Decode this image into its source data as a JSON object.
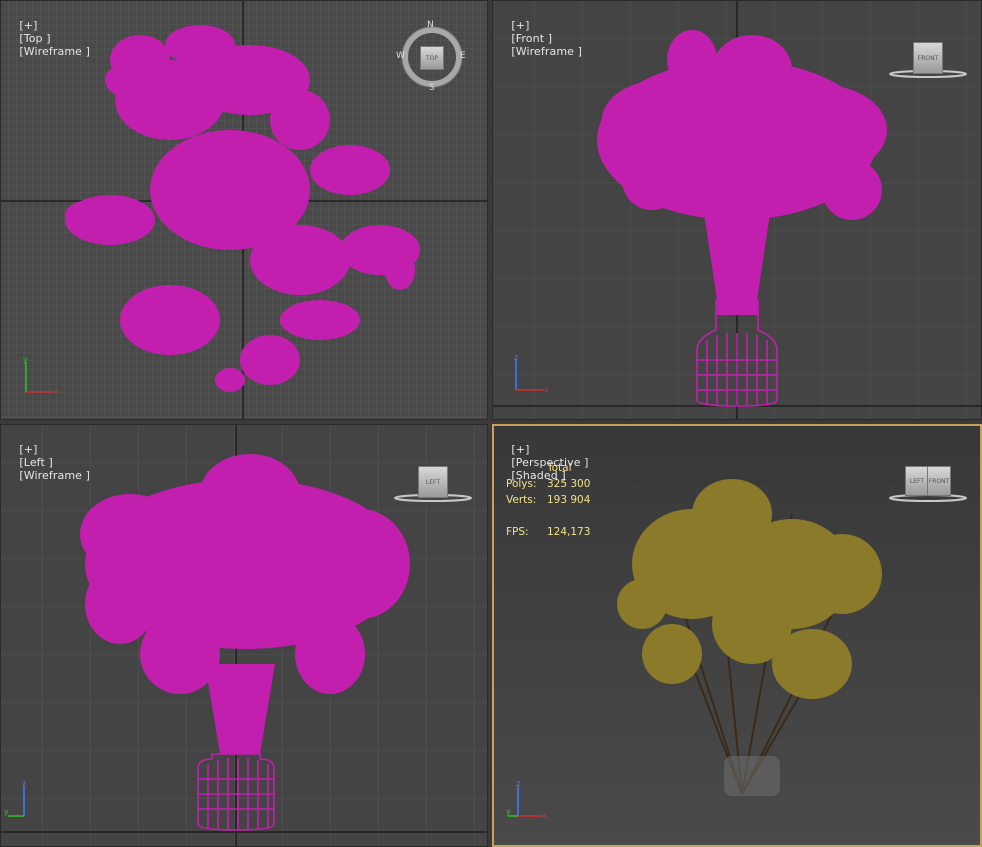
{
  "viewports": {
    "top": {
      "plus": "[+]",
      "name": "[Top ]",
      "mode": "[Wireframe ]"
    },
    "front": {
      "plus": "[+]",
      "name": "[Front ]",
      "mode": "[Wireframe ]"
    },
    "left": {
      "plus": "[+]",
      "name": "[Left ]",
      "mode": "[Wireframe ]"
    },
    "persp": {
      "plus": "[+]",
      "name": "[Perspective ]",
      "mode": "[Shaded ]"
    }
  },
  "viewcube": {
    "top": "TOP",
    "front": "FRONT",
    "left": "LEFT",
    "persp_left": "LEFT",
    "persp_front": "FRONT",
    "compass": {
      "n": "N",
      "s": "S",
      "e": "E",
      "w": "W"
    }
  },
  "stats": {
    "header": "Total",
    "polys_label": "Polys:",
    "polys_value": "325 300",
    "verts_label": "Verts:",
    "verts_value": "193 904",
    "fps_label": "FPS:",
    "fps_value": "124,173"
  },
  "axes": {
    "x": "x",
    "y": "y",
    "z": "z"
  },
  "colors": {
    "wire": "#c21fae",
    "grid": "#5a5a5a",
    "leaf": "#8a7a2a",
    "branch": "#3a2a1a",
    "accent": "#c8a25a",
    "stats": "#f2e08a"
  }
}
